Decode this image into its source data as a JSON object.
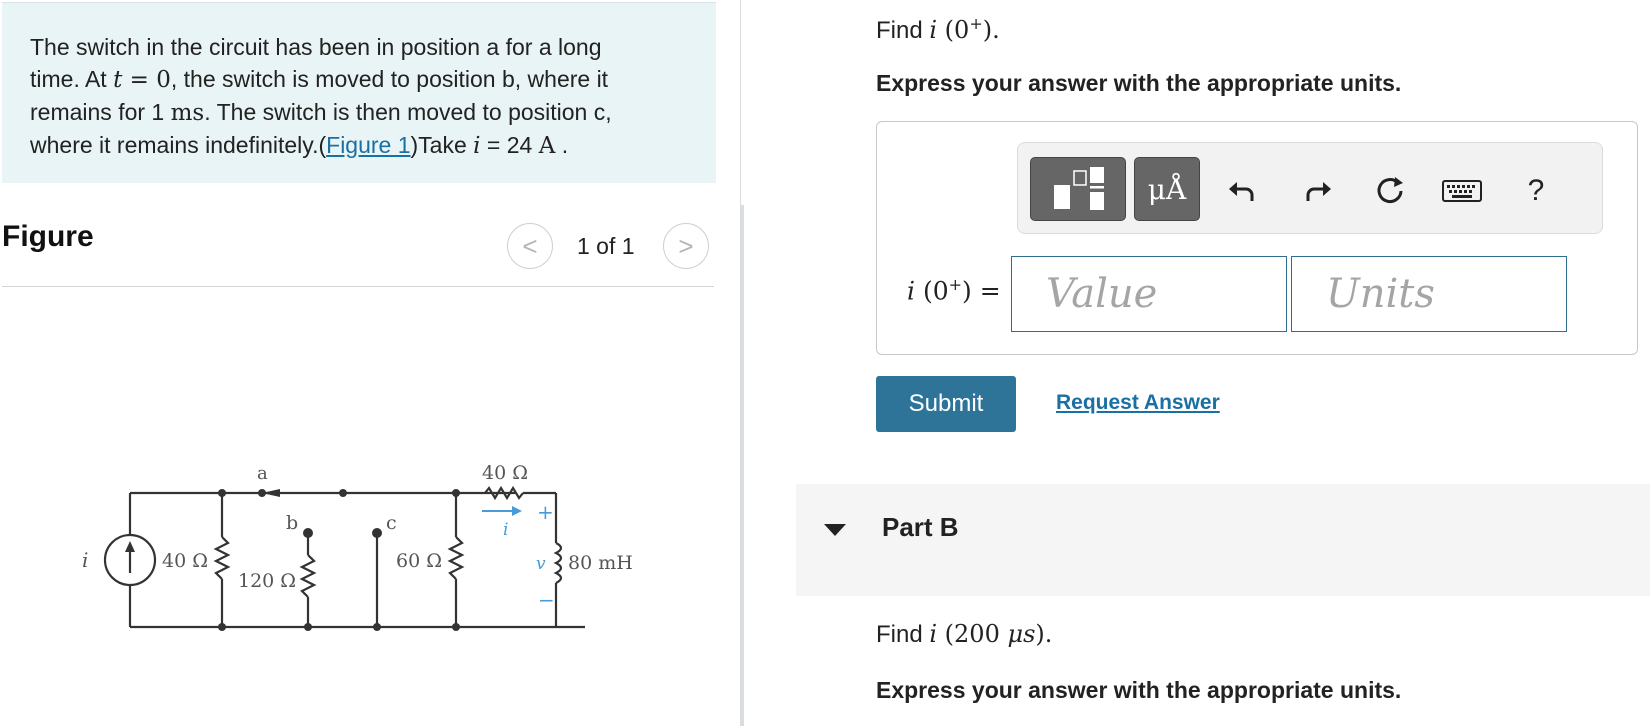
{
  "problem": {
    "line1": "The switch in the circuit has been in position a for a long",
    "line2_pre": "time. At ",
    "line2_t": "t",
    "line2_eq": " = 0",
    "line2_post": ", the switch is moved to position b, where it",
    "line3_pre": "remains for 1 ",
    "line3_unit": "ms",
    "line3_post": ". The switch is then moved to position c,",
    "line4_pre": "where it remains indefinitely.(",
    "line4_link": "Figure 1",
    "line4_mid": ")Take ",
    "line4_i": "i",
    "line4_val": " = 24 ",
    "line4_unit": "A",
    "line4_end": " ."
  },
  "figure": {
    "title": "Figure",
    "pager": "1 of 1",
    "prev_glyph": "<",
    "next_glyph": ">"
  },
  "circuit": {
    "label_a": "a",
    "label_b": "b",
    "label_c": "c",
    "r_top": "40 Ω",
    "r1": "40 Ω",
    "r2": "120 Ω",
    "r3": "60 Ω",
    "inductor": "80 mH",
    "src_label": "i",
    "cur_label": "i",
    "v_label": "v",
    "plus": "+",
    "minus": "−"
  },
  "partA": {
    "find_pre": "Find ",
    "find_var": "i",
    "find_arg": " (0",
    "find_sup": "+",
    "find_close": ").",
    "express": "Express your answer with the appropriate units.",
    "label_var": "i",
    "label_arg": " (0",
    "label_sup": "+",
    "label_close": ") =",
    "value_placeholder": "Value",
    "units_placeholder": "Units",
    "units_button": "μÅ",
    "help": "?",
    "submit": "Submit",
    "request": "Request Answer"
  },
  "partB": {
    "title": "Part B",
    "find_pre": "Find ",
    "find_var": "i",
    "find_open": " (200 ",
    "find_unit": "μs",
    "find_close": ").",
    "express": "Express your answer with the appropriate units."
  }
}
